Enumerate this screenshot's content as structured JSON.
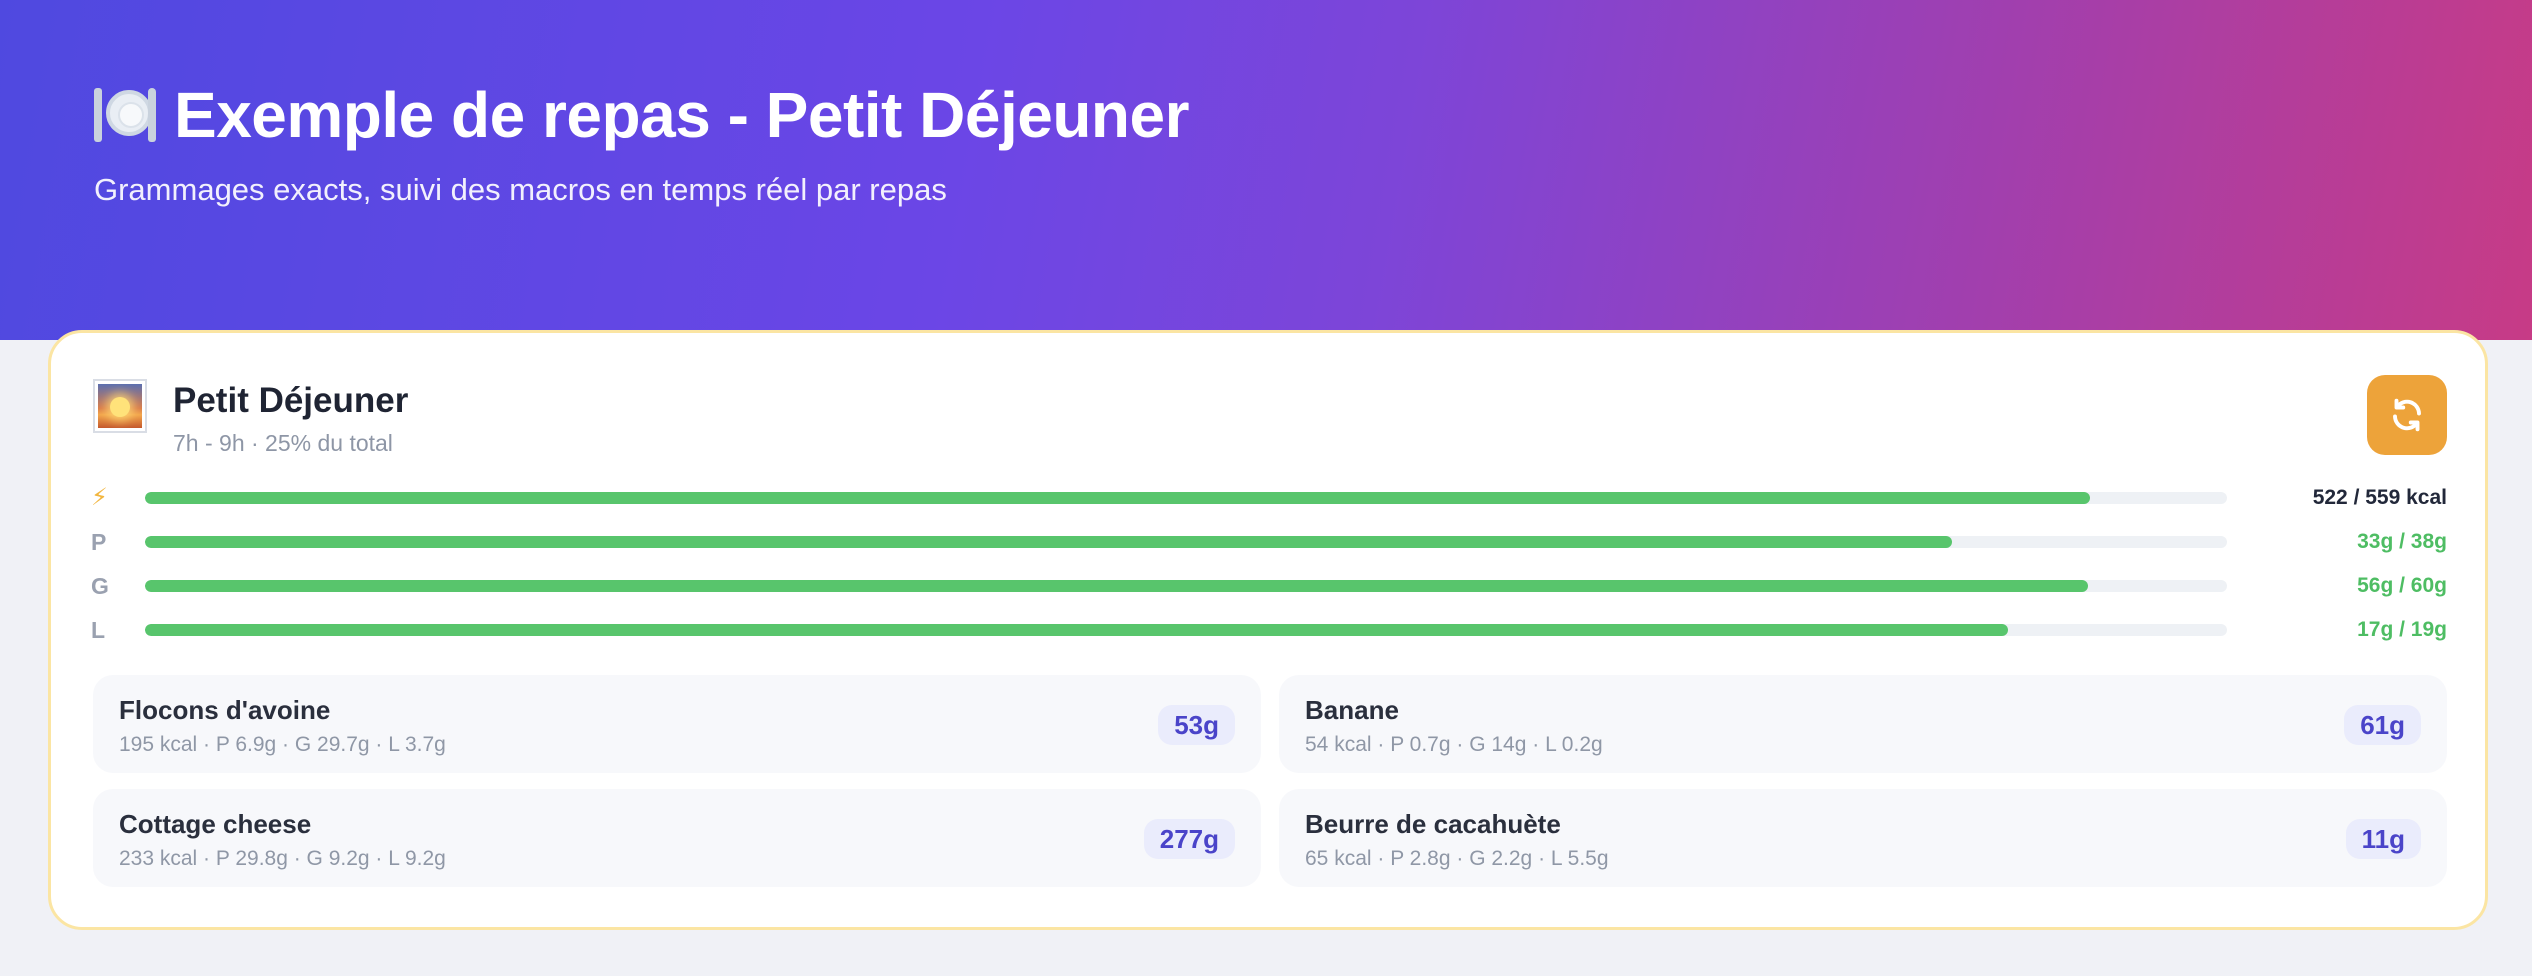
{
  "hero": {
    "title": "Exemple de repas - Petit Déjeuner",
    "subtitle": "Grammages exacts, suivi des macros en temps réel par repas",
    "icon": "fork-plate-knife-icon"
  },
  "meal": {
    "title": "Petit Déjeuner",
    "subtitle": "7h - 9h · 25% du total",
    "icon": "sunrise-icon",
    "refresh_icon": "refresh-icon"
  },
  "macros": [
    {
      "label": "⚡",
      "value": "522 / 559 kcal",
      "progress": 0.934
    },
    {
      "label": "P",
      "value": "33g / 38g",
      "progress": 0.868
    },
    {
      "label": "G",
      "value": "56g / 60g",
      "progress": 0.933
    },
    {
      "label": "L",
      "value": "17g / 19g",
      "progress": 0.895
    }
  ],
  "foods": [
    {
      "name": "Flocons d'avoine",
      "macros": "195 kcal · P 6.9g · G 29.7g · L 3.7g",
      "qty": "53g"
    },
    {
      "name": "Banane",
      "macros": "54 kcal · P 0.7g · G 14g · L 0.2g",
      "qty": "61g"
    },
    {
      "name": "Cottage cheese",
      "macros": "233 kcal · P 29.8g · G 9.2g · L 9.2g",
      "qty": "277g"
    },
    {
      "name": "Beurre de cacahuète",
      "macros": "65 kcal · P 2.8g · G 2.2g · L 5.5g",
      "qty": "11g"
    }
  ],
  "colors": {
    "accent": "#5b4be3",
    "progress": "#58c56c",
    "refresh_button": "#eda33a",
    "card_border": "#fbe5a3"
  }
}
